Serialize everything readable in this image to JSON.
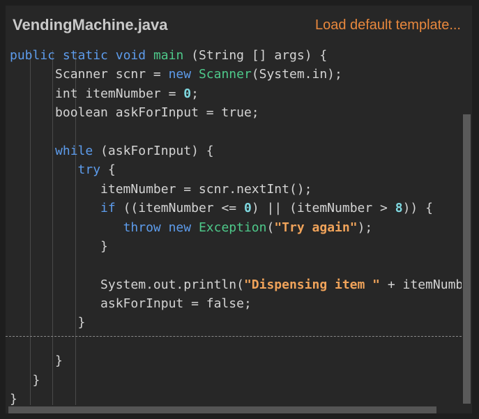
{
  "header": {
    "filename": "VendingMachine.java",
    "load_template_label": "Load default template..."
  },
  "editor": {
    "lines": [
      [
        {
          "t": "public",
          "c": "kw"
        },
        {
          "t": " "
        },
        {
          "t": "static",
          "c": "kw"
        },
        {
          "t": " "
        },
        {
          "t": "void",
          "c": "kw"
        },
        {
          "t": " "
        },
        {
          "t": "main",
          "c": "cls"
        },
        {
          "t": " (String [] args) {"
        }
      ],
      [
        {
          "t": "      Scanner scnr = "
        },
        {
          "t": "new",
          "c": "kw"
        },
        {
          "t": " "
        },
        {
          "t": "Scanner",
          "c": "cls"
        },
        {
          "t": "(System.in);"
        }
      ],
      [
        {
          "t": "      int itemNumber = "
        },
        {
          "t": "0",
          "c": "num"
        },
        {
          "t": ";"
        }
      ],
      [
        {
          "t": "      boolean askForInput = true;"
        }
      ],
      [
        {
          "t": ""
        }
      ],
      [
        {
          "t": "      "
        },
        {
          "t": "while",
          "c": "kw"
        },
        {
          "t": " (askForInput) {"
        }
      ],
      [
        {
          "t": "         "
        },
        {
          "t": "try",
          "c": "kw"
        },
        {
          "t": " {"
        }
      ],
      [
        {
          "t": "            itemNumber = scnr.nextInt();"
        }
      ],
      [
        {
          "t": "            "
        },
        {
          "t": "if",
          "c": "kw"
        },
        {
          "t": " ((itemNumber <= "
        },
        {
          "t": "0",
          "c": "num"
        },
        {
          "t": ") || (itemNumber > "
        },
        {
          "t": "8",
          "c": "num"
        },
        {
          "t": ")) {"
        }
      ],
      [
        {
          "t": "               "
        },
        {
          "t": "throw",
          "c": "kw"
        },
        {
          "t": " "
        },
        {
          "t": "new",
          "c": "kw"
        },
        {
          "t": " "
        },
        {
          "t": "Exception",
          "c": "cls"
        },
        {
          "t": "("
        },
        {
          "t": "\"Try again\"",
          "c": "str"
        },
        {
          "t": ");"
        }
      ],
      [
        {
          "t": "            }"
        }
      ],
      [
        {
          "t": ""
        }
      ],
      [
        {
          "t": "            System.out.println("
        },
        {
          "t": "\"Dispensing item \"",
          "c": "str"
        },
        {
          "t": " + itemNumber);"
        }
      ],
      [
        {
          "t": "            askForInput = false;"
        }
      ],
      [
        {
          "t": "         }"
        }
      ],
      [
        {
          "t": ""
        }
      ],
      [
        {
          "t": "      }"
        }
      ],
      [
        {
          "t": "   }"
        }
      ],
      [
        {
          "t": "}"
        }
      ]
    ]
  },
  "colors": {
    "keyword": "#5d9cec",
    "class": "#4ec98a",
    "number": "#7fd8e0",
    "string": "#f0a35a",
    "accent": "#e8883d"
  }
}
